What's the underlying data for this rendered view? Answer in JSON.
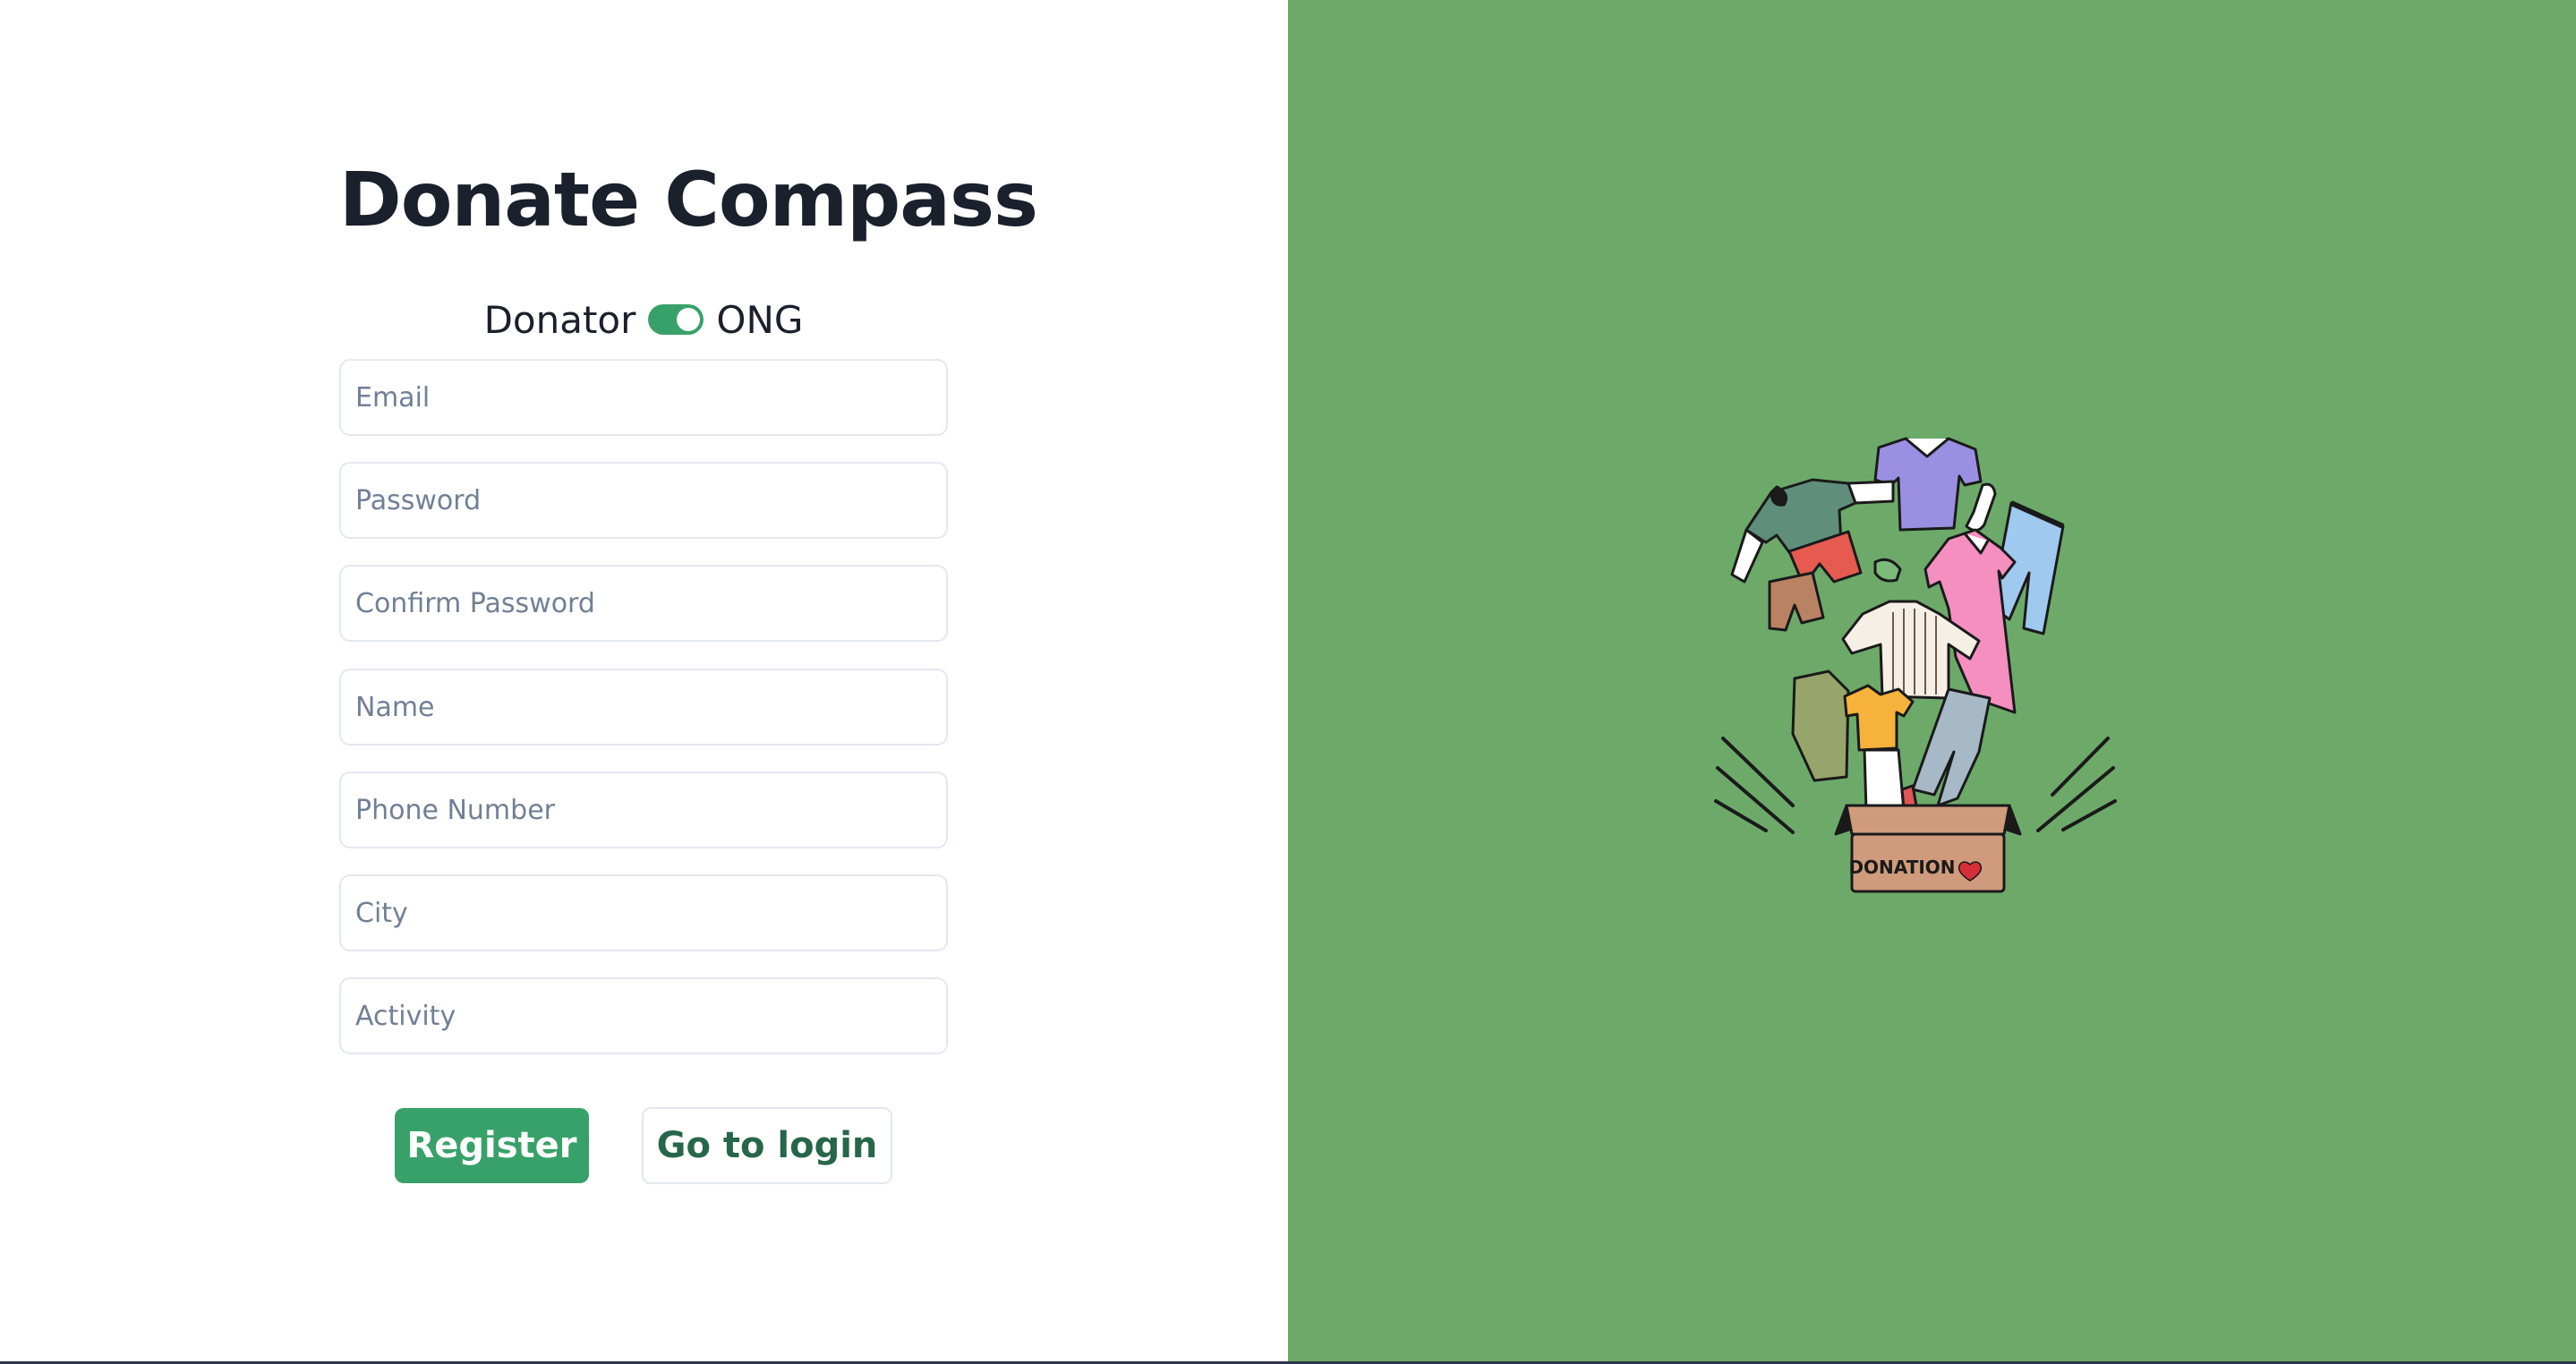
{
  "app": {
    "title": "Donate Compass"
  },
  "account_type": {
    "left_label": "Donator",
    "right_label": "ONG",
    "selected": "ONG"
  },
  "form": {
    "email": {
      "placeholder": "Email",
      "value": ""
    },
    "password": {
      "placeholder": "Password",
      "value": ""
    },
    "confirm_password": {
      "placeholder": "Confirm Password",
      "value": ""
    },
    "name": {
      "placeholder": "Name",
      "value": ""
    },
    "phone": {
      "placeholder": "Phone Number",
      "value": ""
    },
    "city": {
      "placeholder": "City",
      "value": ""
    },
    "activity": {
      "placeholder": "Activity",
      "value": ""
    }
  },
  "buttons": {
    "register": "Register",
    "go_to_login": "Go to login"
  },
  "illustration": {
    "box_label": "DONATION",
    "icon": "heart-icon"
  },
  "colors": {
    "accent": "#38a169",
    "panel_bg": "#6daa6a",
    "title": "#1a202c",
    "login_text": "#276749"
  }
}
